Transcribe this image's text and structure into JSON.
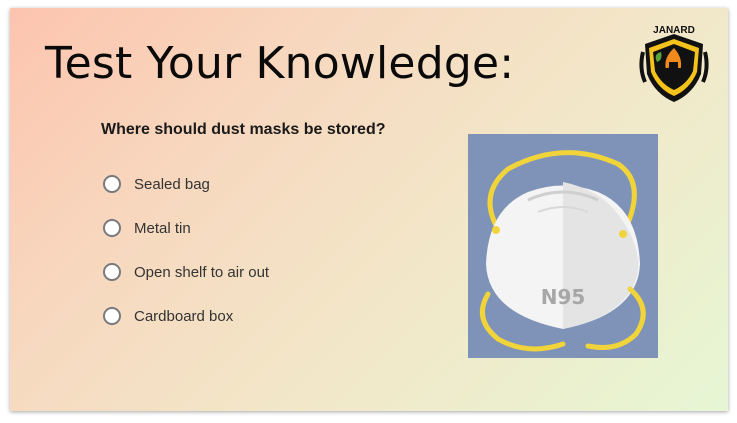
{
  "slide": {
    "title": "Test Your Knowledge:",
    "logo_text": "JANARD",
    "question": "Where should dust masks be stored?",
    "options": [
      {
        "label": "Sealed bag",
        "selected": false
      },
      {
        "label": "Metal tin",
        "selected": false
      },
      {
        "label": "Open shelf to air out",
        "selected": false
      },
      {
        "label": "Cardboard box",
        "selected": false
      }
    ],
    "image": {
      "subject": "n95-mask-icon",
      "mask_text": "N95",
      "background_color": "#7f93b8",
      "strap_color": "#f0d43a"
    }
  }
}
